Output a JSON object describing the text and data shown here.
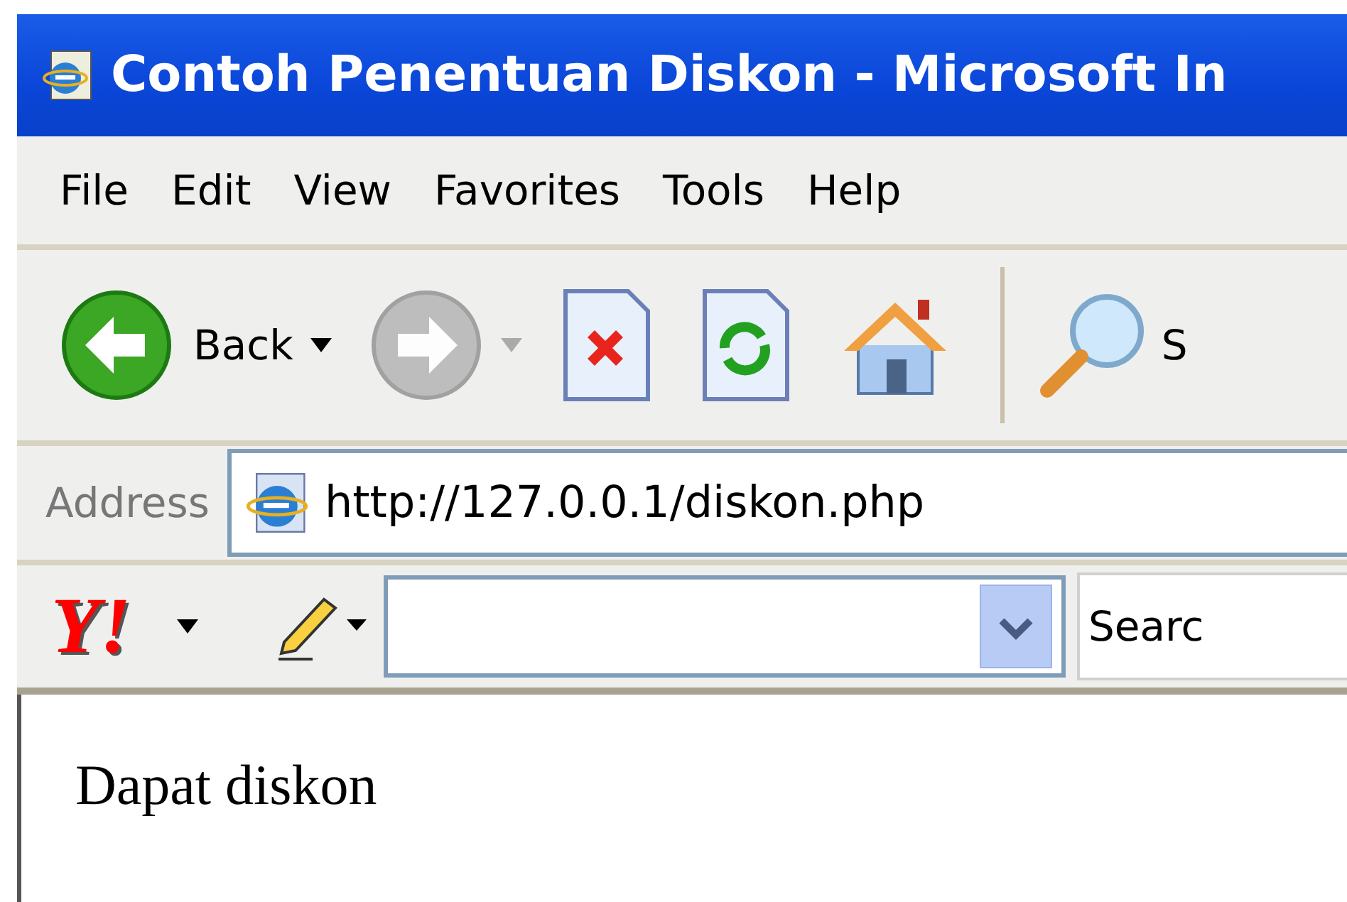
{
  "window": {
    "title": "Contoh Penentuan Diskon - Microsoft In"
  },
  "menu": [
    "File",
    "Edit",
    "View",
    "Favorites",
    "Tools",
    "Help"
  ],
  "toolbar": {
    "back": {
      "label": "Back",
      "disabled": false
    },
    "forward": {
      "disabled": true
    },
    "search_label": "S"
  },
  "address_bar": {
    "label": "Address",
    "value": "http://127.0.0.1/diskon.php"
  },
  "yahoo_toolbar": {
    "logo": "Y!",
    "search_button": "Searc"
  },
  "page": {
    "text": "Dapat diskon"
  }
}
